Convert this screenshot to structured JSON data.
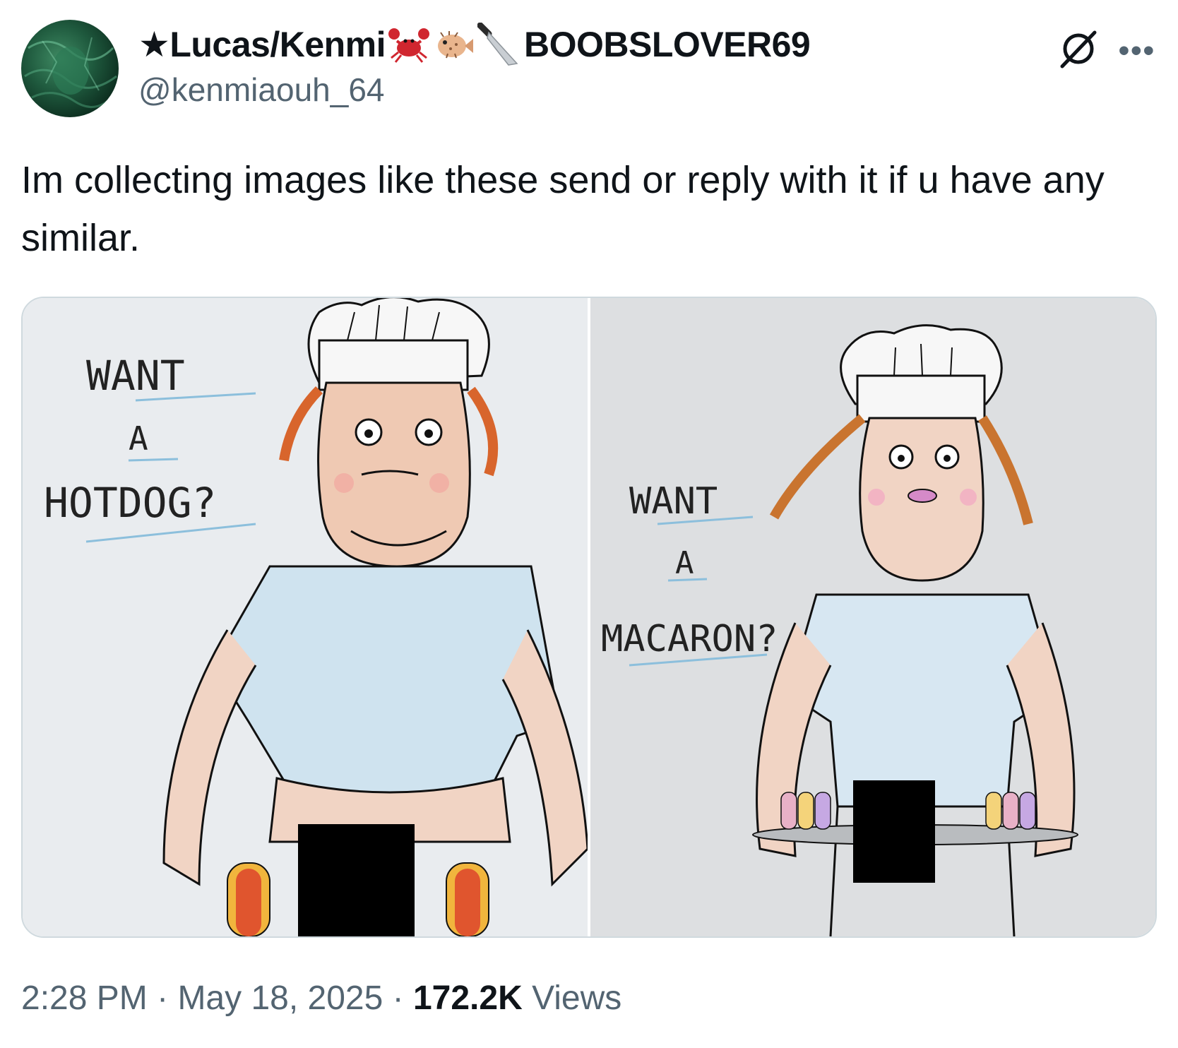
{
  "author": {
    "display_name": "★Lucas/Kenmi",
    "name_suffix": "BOOBSLOVER69",
    "emoji": [
      "crab-emoji",
      "blowfish-emoji",
      "knife-emoji"
    ],
    "handle": "@kenmiaouh_64"
  },
  "tweet": {
    "text": "Im collecting images like these send or reply with it if u have any similar."
  },
  "media": {
    "left": {
      "caption_lines": [
        "WANT",
        "A",
        "HOTDOG?"
      ]
    },
    "right": {
      "caption_lines": [
        "WANT",
        "A",
        "MACARON?"
      ]
    }
  },
  "meta": {
    "time": "2:28 PM",
    "date": "May 18, 2025",
    "views_count": "172.2K",
    "views_label": "Views",
    "separator": "·"
  },
  "colors": {
    "text_primary": "#0f1419",
    "text_secondary": "#536471",
    "border": "#cfd9de"
  }
}
